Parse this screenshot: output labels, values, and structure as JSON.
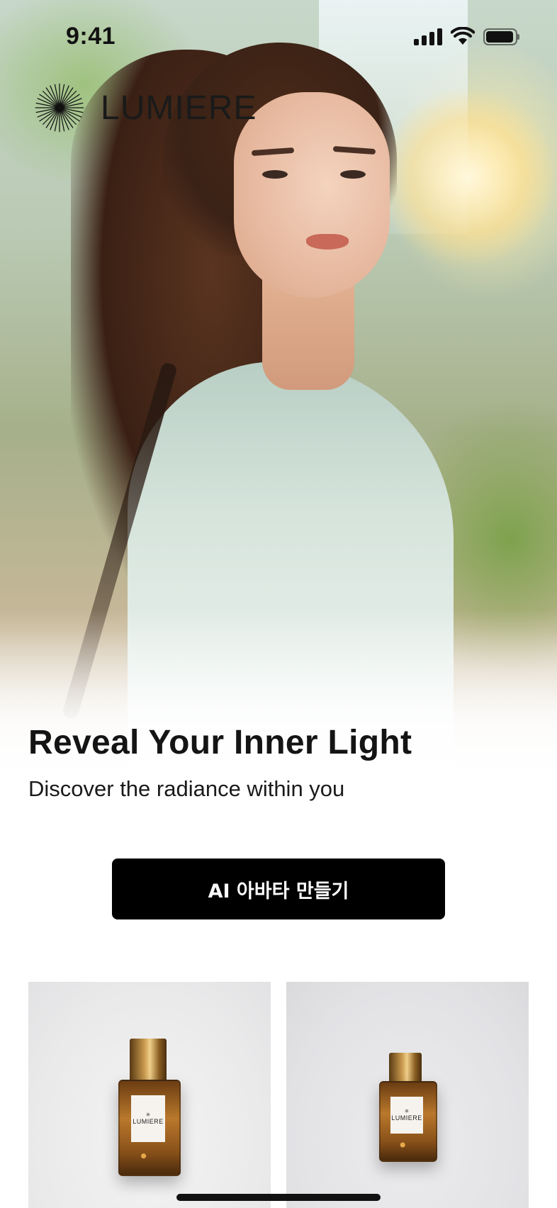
{
  "status_bar": {
    "time": "9:41"
  },
  "brand": {
    "name": "LUMIERE"
  },
  "hero": {
    "headline": "Reveal Your Inner Light",
    "subhead": "Discover the radiance within you"
  },
  "cta": {
    "label": "AI 아바타 만들기"
  },
  "products": [
    {
      "label": "LUMIERE"
    },
    {
      "label": "LUMIERE"
    }
  ],
  "icons": {
    "brand_mark": "sunburst-icon",
    "signal": "cellular-signal-icon",
    "wifi": "wifi-icon",
    "battery": "battery-icon"
  }
}
